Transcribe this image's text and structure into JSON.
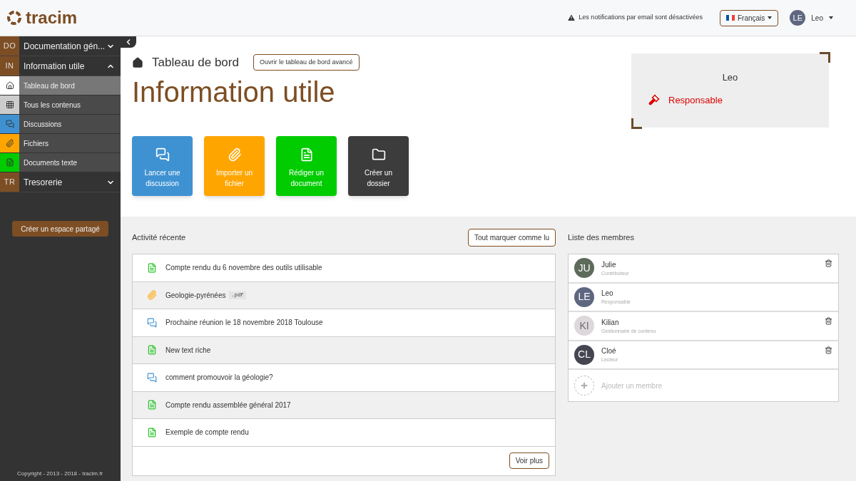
{
  "header": {
    "logo": "tracim",
    "notification": "Les notifications par email sont désactivées",
    "language": "Français",
    "user": {
      "initials": "LE",
      "name": "Leo"
    }
  },
  "sidebar": {
    "workspaces": [
      {
        "initials": "DO",
        "name": "Documentation gén...",
        "expanded": false
      },
      {
        "initials": "IN",
        "name": "Information utile",
        "expanded": true,
        "items": [
          {
            "kind": "dashboard",
            "label": "Tableau de bord",
            "color": "#ffffff",
            "selected": true
          },
          {
            "kind": "all",
            "label": "Tous les contenus",
            "color": "#cccccc",
            "selected": false
          },
          {
            "kind": "thread",
            "label": "Discussions",
            "color": "#3f92d2",
            "selected": false
          },
          {
            "kind": "file",
            "label": "Fichiers",
            "color": "#ffa500",
            "selected": false
          },
          {
            "kind": "document",
            "label": "Documents texte",
            "color": "#00cc00",
            "selected": false
          }
        ]
      },
      {
        "initials": "TR",
        "name": "Tresorerie",
        "expanded": false
      }
    ],
    "create_button": "Créer un espace partagé",
    "copyright": "Copyright - 2013 - 2018 - tracim.fr"
  },
  "page": {
    "breadcrumb": "Tableau de bord",
    "advanced_button": "Ouvrir le tableau de bord avancé",
    "title": "Information utile",
    "user_card": {
      "name": "Leo",
      "role": "Responsable"
    },
    "actions": [
      {
        "kind": "thread",
        "label": "Lancer une discussion",
        "color": "#3f92d2"
      },
      {
        "kind": "file",
        "label": "Importer un fichier",
        "color": "#ffa500"
      },
      {
        "kind": "document",
        "label": "Rédiger un document",
        "color": "#00cc00"
      },
      {
        "kind": "folder",
        "label": "Créer un dossier",
        "color": "#3c3c3c"
      }
    ]
  },
  "activity": {
    "title": "Activité récente",
    "mark_all": "Tout marquer comme lu",
    "items": [
      {
        "kind": "document",
        "label": "Compte rendu du 6 novembre des outils utilisable"
      },
      {
        "kind": "file",
        "label": "Geologie-pyrénées",
        "extension": ".pdf"
      },
      {
        "kind": "thread",
        "label": "Prochaine réunion le 18 novembre 2018 Toulouse"
      },
      {
        "kind": "document",
        "label": "New text riche"
      },
      {
        "kind": "thread",
        "label": "comment promouvoir la géologie?"
      },
      {
        "kind": "document",
        "label": "Compte rendu assemblée général 2017"
      },
      {
        "kind": "document",
        "label": "Exemple de compte rendu"
      }
    ],
    "more_button": "Voir plus"
  },
  "members": {
    "title": "Liste des membres",
    "items": [
      {
        "initials": "JU",
        "name": "Julie",
        "role": "Contributeur",
        "color": "#5d6b5b",
        "removable": true
      },
      {
        "initials": "LE",
        "name": "Leo",
        "role": "Responsable",
        "color": "#5e6680",
        "removable": false
      },
      {
        "initials": "KI",
        "name": "Kilian",
        "role": "Gestionnaire de contenu",
        "color": "#dcd8dc",
        "removable": true
      },
      {
        "initials": "CL",
        "name": "Cloé",
        "role": "Lecteur",
        "color": "#454552",
        "removable": true
      }
    ],
    "add_label": "Ajouter un membre"
  }
}
